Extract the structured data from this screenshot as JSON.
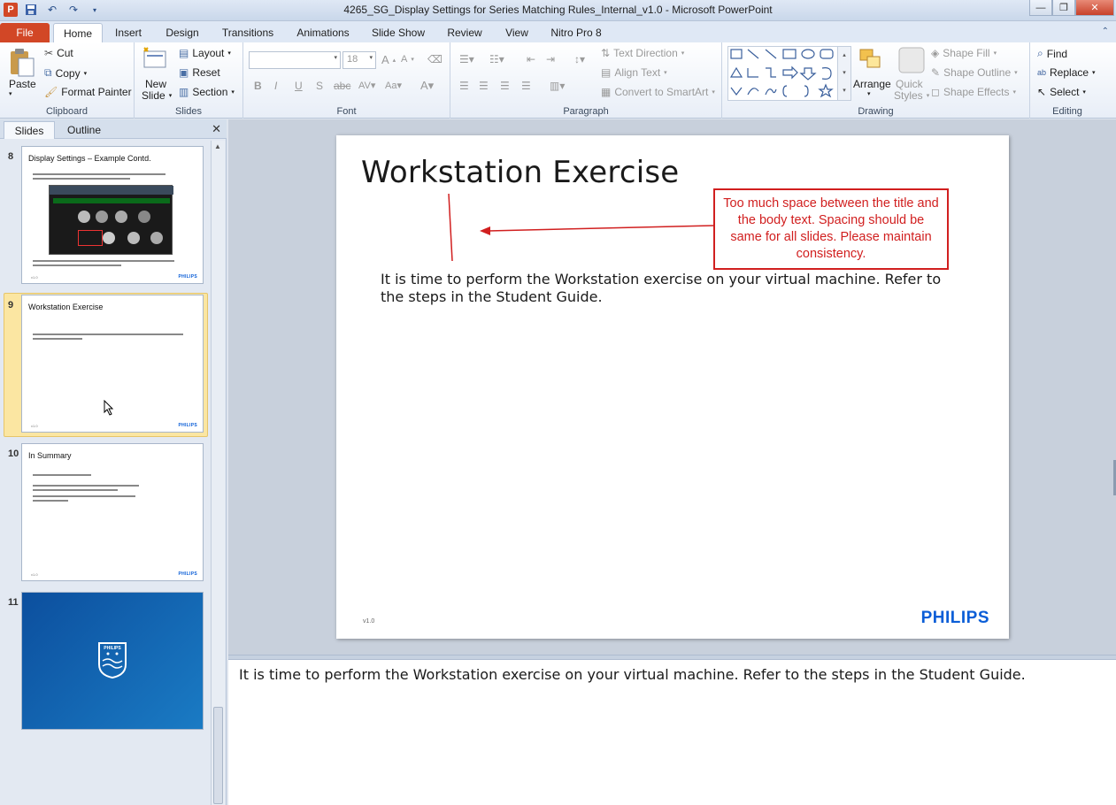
{
  "app": {
    "title": "4265_SG_Display Settings for Series Matching Rules_Internal_v1.0  -  Microsoft PowerPoint",
    "logo_letter": "P"
  },
  "ribbon_tabs": [
    "File",
    "Home",
    "Insert",
    "Design",
    "Transitions",
    "Animations",
    "Slide Show",
    "Review",
    "View",
    "Nitro Pro 8"
  ],
  "active_tab": "Home",
  "clipboard": {
    "paste": "Paste",
    "cut": "Cut",
    "copy": "Copy",
    "format_painter": "Format Painter",
    "label": "Clipboard"
  },
  "slides_group": {
    "new_slide": "New",
    "new_slide2": "Slide",
    "layout": "Layout",
    "reset": "Reset",
    "section": "Section",
    "label": "Slides"
  },
  "font_group": {
    "font_size": "18",
    "label": "Font"
  },
  "paragraph_group": {
    "text_direction": "Text Direction",
    "align_text": "Align Text",
    "convert_smartart": "Convert to SmartArt",
    "label": "Paragraph"
  },
  "drawing_group": {
    "arrange": "Arrange",
    "quick_styles": "Quick",
    "quick_styles2": "Styles",
    "shape_fill": "Shape Fill",
    "shape_outline": "Shape Outline",
    "shape_effects": "Shape Effects",
    "label": "Drawing"
  },
  "editing_group": {
    "find": "Find",
    "replace": "Replace",
    "select": "Select",
    "label": "Editing"
  },
  "pane_tabs": {
    "slides": "Slides",
    "outline": "Outline"
  },
  "thumbnails": [
    {
      "num": "8",
      "title": "Display Settings – Example Contd.",
      "logo": "PHILIPS",
      "ver": "v1.0"
    },
    {
      "num": "9",
      "title": "Workstation Exercise",
      "logo": "PHILIPS",
      "ver": "v1.0"
    },
    {
      "num": "10",
      "title": "In Summary",
      "logo": "PHILIPS",
      "ver": "v1.0"
    },
    {
      "num": "11",
      "logo": "PHILIPS"
    }
  ],
  "slide": {
    "title": "Workstation Exercise",
    "body": "It is time to perform the Workstation exercise on your virtual machine. Refer to the steps in the Student Guide.",
    "version": "v1.0",
    "logo": "PHILIPS",
    "callout": "Too much space between the title and the body text. Spacing should be same for all slides. Please maintain consistency."
  },
  "notes": {
    "text": "It is time to perform the Workstation exercise on your virtual machine. Refer to the steps in the Student Guide."
  },
  "colors": {
    "file_tab": "#d24726",
    "callout_red": "#d11f1f",
    "philips_blue": "#0b5ed7",
    "selection": "#fbe6a2"
  }
}
